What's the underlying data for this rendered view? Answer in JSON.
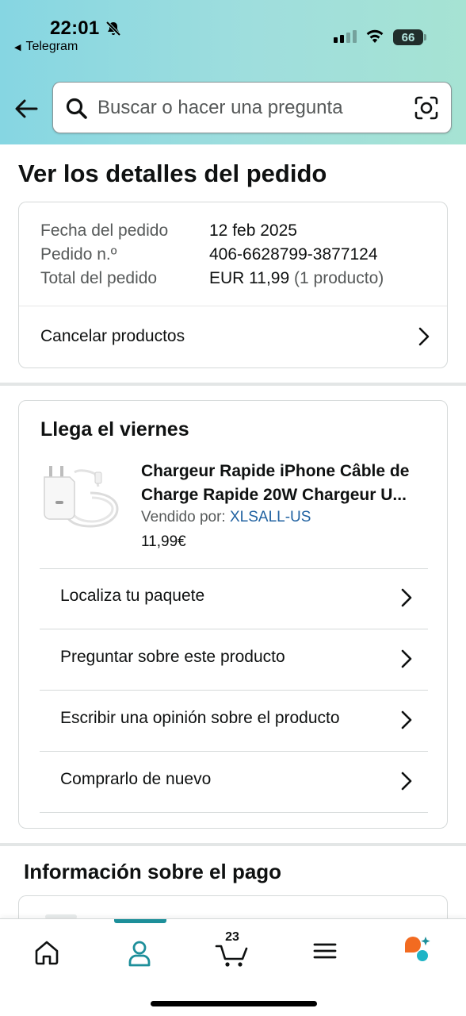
{
  "status_bar": {
    "time": "22:01",
    "back_app": "Telegram",
    "battery": "66"
  },
  "search": {
    "placeholder": "Buscar o hacer una pregunta"
  },
  "page": {
    "title": "Ver los detalles del pedido"
  },
  "order_summary": {
    "rows": [
      {
        "label": "Fecha del pedido",
        "value": "12 feb 2025"
      },
      {
        "label": "Pedido n.º",
        "value": "406-6628799-3877124"
      },
      {
        "label": "Total del pedido",
        "value": "EUR 11,99",
        "extra": "(1 producto)"
      }
    ],
    "cancel_label": "Cancelar productos"
  },
  "delivery": {
    "title": "Llega el viernes",
    "product": {
      "name": "Chargeur Rapide iPhone Câble de Charge Rapide 20W Chargeur U...",
      "sold_by_label": "Vendido por:",
      "seller": "XLSALL-US",
      "price": "11,99€"
    },
    "actions": [
      {
        "label": "Localiza tu paquete"
      },
      {
        "label": "Preguntar sobre este producto"
      },
      {
        "label": "Escribir una opinión sobre el producto"
      },
      {
        "label": "Comprarlo de nuevo"
      }
    ]
  },
  "payment": {
    "title": "Información sobre el pago"
  },
  "bottom_nav": {
    "active": "account",
    "items": [
      {
        "id": "home",
        "icon": "home-icon"
      },
      {
        "id": "account",
        "icon": "person-icon"
      },
      {
        "id": "cart",
        "icon": "cart-icon",
        "count": "23"
      },
      {
        "id": "menu",
        "icon": "hamburger-menu-icon"
      },
      {
        "id": "rufus",
        "icon": "rufus-assistant-icon"
      }
    ]
  },
  "colors": {
    "link": "#2162a1",
    "accent": "#1d8f9a",
    "header_gradient_start": "#86d6e2",
    "header_gradient_end": "#a6e3d3"
  }
}
